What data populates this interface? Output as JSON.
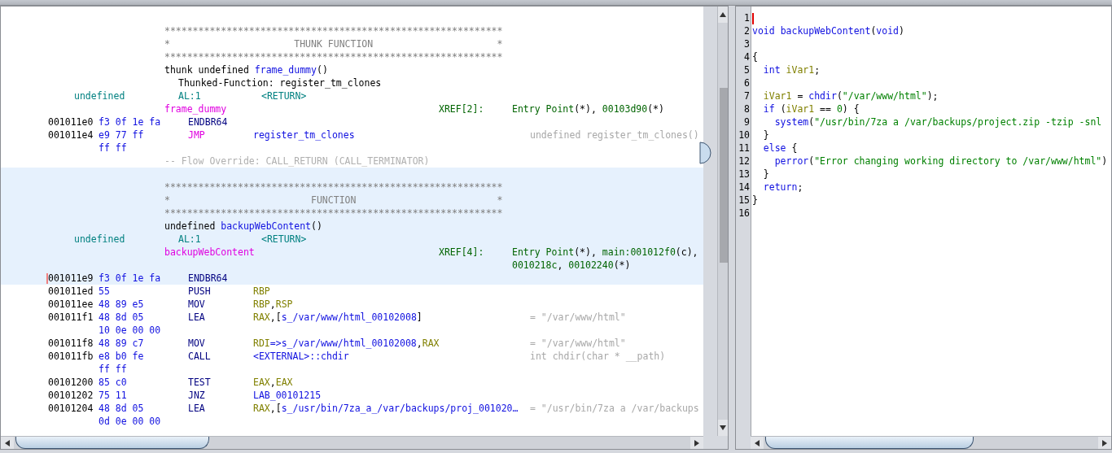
{
  "listing": {
    "lines": [
      {
        "kind": "blank",
        "highlighted": false
      },
      {
        "kind": "banner",
        "highlighted": false,
        "text": "************************************************************"
      },
      {
        "kind": "banner",
        "highlighted": false,
        "text": "*                      THUNK FUNCTION                      *"
      },
      {
        "kind": "banner",
        "highlighted": false,
        "text": "************************************************************"
      },
      {
        "kind": "signature",
        "highlighted": false,
        "tokens": [
          {
            "text": "thunk undefined ",
            "kind": "plain"
          },
          {
            "text": "frame_dummy",
            "kind": "sym"
          },
          {
            "text": "()",
            "kind": "plain"
          }
        ]
      },
      {
        "kind": "thunked",
        "highlighted": false,
        "text": "Thunked-Function: register_tm_clones"
      },
      {
        "kind": "return",
        "highlighted": false,
        "type": "undefined",
        "storage": "AL:1",
        "name": "<RETURN>"
      },
      {
        "kind": "label",
        "highlighted": false,
        "name": "frame_dummy",
        "xref_label": "XREF[2]:",
        "xrefs": [
          {
            "text": "Entry Point",
            "kind": "ref"
          },
          {
            "text": "(*), ",
            "kind": "plain"
          },
          {
            "text": "00103d90",
            "kind": "ref"
          },
          {
            "text": "(*)",
            "kind": "plain"
          }
        ]
      },
      {
        "kind": "instruction",
        "highlighted": false,
        "cursor": false,
        "address": "001011e0",
        "bytes": "f3 0f 1e fa",
        "mnemonic": "ENDBR64",
        "jump": false
      },
      {
        "kind": "instruction",
        "highlighted": false,
        "cursor": false,
        "address": "001011e4",
        "bytes": "e9 77 ff",
        "mnemonic": "JMP",
        "jump": true,
        "operands": [
          {
            "text": "register_tm_clones",
            "kind": "sym"
          }
        ],
        "comment": "undefined register_tm_clones()"
      },
      {
        "kind": "continuation",
        "highlighted": false,
        "bytes": "ff ff"
      },
      {
        "kind": "flow_override",
        "highlighted": false,
        "text": "-- Flow Override: CALL_RETURN (CALL_TERMINATOR)"
      },
      {
        "kind": "blank",
        "highlighted": true
      },
      {
        "kind": "banner",
        "highlighted": true,
        "text": "************************************************************"
      },
      {
        "kind": "banner",
        "highlighted": true,
        "text": "*                         FUNCTION                         *"
      },
      {
        "kind": "banner",
        "highlighted": true,
        "text": "************************************************************"
      },
      {
        "kind": "signature",
        "highlighted": true,
        "tokens": [
          {
            "text": "undefined ",
            "kind": "plain"
          },
          {
            "text": "backupWebContent",
            "kind": "sym"
          },
          {
            "text": "()",
            "kind": "plain"
          }
        ]
      },
      {
        "kind": "return",
        "highlighted": true,
        "type": "undefined",
        "storage": "AL:1",
        "name": "<RETURN>"
      },
      {
        "kind": "label",
        "highlighted": true,
        "name": "backupWebContent",
        "xref_label": "XREF[4]:",
        "xrefs": [
          {
            "text": "Entry Point",
            "kind": "ref"
          },
          {
            "text": "(*), ",
            "kind": "plain"
          },
          {
            "text": "main:001012f0",
            "kind": "ref"
          },
          {
            "text": "(c),",
            "kind": "plain"
          }
        ]
      },
      {
        "kind": "xref_more",
        "highlighted": true,
        "xrefs": [
          {
            "text": "0010218c",
            "kind": "ref"
          },
          {
            "text": ", ",
            "kind": "plain"
          },
          {
            "text": "00102240",
            "kind": "ref"
          },
          {
            "text": "(*)",
            "kind": "plain"
          }
        ]
      },
      {
        "kind": "instruction",
        "highlighted": true,
        "cursor": true,
        "address": "001011e9",
        "bytes": "f3 0f 1e fa",
        "mnemonic": "ENDBR64",
        "jump": false
      },
      {
        "kind": "instruction",
        "highlighted": false,
        "cursor": false,
        "address": "001011ed",
        "bytes": "55",
        "mnemonic": "PUSH",
        "jump": false,
        "operands": [
          {
            "text": "RBP",
            "kind": "reg"
          }
        ]
      },
      {
        "kind": "instruction",
        "highlighted": false,
        "cursor": false,
        "address": "001011ee",
        "bytes": "48 89 e5",
        "mnemonic": "MOV",
        "jump": false,
        "operands": [
          {
            "text": "RBP",
            "kind": "reg"
          },
          {
            "text": ",",
            "kind": "plain"
          },
          {
            "text": "RSP",
            "kind": "reg"
          }
        ]
      },
      {
        "kind": "instruction",
        "highlighted": false,
        "cursor": false,
        "address": "001011f1",
        "bytes": "48 8d 05",
        "mnemonic": "LEA",
        "jump": false,
        "operands": [
          {
            "text": "RAX",
            "kind": "reg"
          },
          {
            "text": ",[",
            "kind": "plain"
          },
          {
            "text": "s_/var/www/html_00102008",
            "kind": "sym"
          },
          {
            "text": "]",
            "kind": "plain"
          }
        ],
        "comment": "= \"/var/www/html\""
      },
      {
        "kind": "continuation",
        "highlighted": false,
        "bytes": "10 0e 00 00"
      },
      {
        "kind": "instruction",
        "highlighted": false,
        "cursor": false,
        "address": "001011f8",
        "bytes": "48 89 c7",
        "mnemonic": "MOV",
        "jump": false,
        "operands": [
          {
            "text": "RDI",
            "kind": "reg"
          },
          {
            "text": "=>s_/var/www/html_00102008",
            "kind": "sym"
          },
          {
            "text": ",",
            "kind": "plain"
          },
          {
            "text": "RAX",
            "kind": "reg"
          }
        ],
        "comment": "= \"/var/www/html\""
      },
      {
        "kind": "instruction",
        "highlighted": false,
        "cursor": false,
        "address": "001011fb",
        "bytes": "e8 b0 fe",
        "mnemonic": "CALL",
        "jump": false,
        "operands": [
          {
            "text": "<EXTERNAL>::chdir",
            "kind": "sym"
          }
        ],
        "comment": "int chdir(char * __path)"
      },
      {
        "kind": "continuation",
        "highlighted": false,
        "bytes": "ff ff"
      },
      {
        "kind": "instruction",
        "highlighted": false,
        "cursor": false,
        "address": "00101200",
        "bytes": "85 c0",
        "mnemonic": "TEST",
        "jump": false,
        "operands": [
          {
            "text": "EAX",
            "kind": "reg"
          },
          {
            "text": ",",
            "kind": "plain"
          },
          {
            "text": "EAX",
            "kind": "reg"
          }
        ]
      },
      {
        "kind": "instruction",
        "highlighted": false,
        "cursor": false,
        "address": "00101202",
        "bytes": "75 11",
        "mnemonic": "JNZ",
        "jump": false,
        "operands": [
          {
            "text": "LAB_00101215",
            "kind": "sym"
          }
        ]
      },
      {
        "kind": "instruction",
        "highlighted": false,
        "cursor": false,
        "address": "00101204",
        "bytes": "48 8d 05",
        "mnemonic": "LEA",
        "jump": false,
        "operands": [
          {
            "text": "RAX",
            "kind": "reg"
          },
          {
            "text": ",[",
            "kind": "plain"
          },
          {
            "text": "s_/usr/bin/7za_a_/var/backups/proj_001020…",
            "kind": "sym"
          }
        ],
        "comment": "= \"/usr/bin/7za a /var/backups"
      },
      {
        "kind": "continuation",
        "highlighted": false,
        "bytes": "0d 0e 00 00"
      }
    ]
  },
  "decompiler": {
    "lines": [
      {
        "number": "1",
        "cursor": true
      },
      {
        "number": "2",
        "cursor": false,
        "tokens": [
          {
            "text": "void ",
            "kind": "kw"
          },
          {
            "text": "backupWebContent",
            "kind": "fn"
          },
          {
            "text": "(",
            "kind": "plain"
          },
          {
            "text": "void",
            "kind": "kw"
          },
          {
            "text": ")",
            "kind": "plain"
          }
        ]
      },
      {
        "number": "3",
        "cursor": false
      },
      {
        "number": "4",
        "cursor": false,
        "tokens": [
          {
            "text": "{",
            "kind": "plain"
          }
        ]
      },
      {
        "number": "5",
        "cursor": false,
        "tokens": [
          {
            "text": "  int ",
            "kind": "kw"
          },
          {
            "text": "iVar1",
            "kind": "var"
          },
          {
            "text": ";",
            "kind": "plain"
          }
        ]
      },
      {
        "number": "6",
        "cursor": false
      },
      {
        "number": "7",
        "cursor": false,
        "tokens": [
          {
            "text": "  iVar1",
            "kind": "var"
          },
          {
            "text": " = ",
            "kind": "plain"
          },
          {
            "text": "chdir",
            "kind": "fn"
          },
          {
            "text": "(",
            "kind": "plain"
          },
          {
            "text": "\"/var/www/html\"",
            "kind": "str"
          },
          {
            "text": ");",
            "kind": "plain"
          }
        ]
      },
      {
        "number": "8",
        "cursor": false,
        "tokens": [
          {
            "text": "  if",
            "kind": "kw"
          },
          {
            "text": " (",
            "kind": "plain"
          },
          {
            "text": "iVar1",
            "kind": "var"
          },
          {
            "text": " == ",
            "kind": "plain"
          },
          {
            "text": "0",
            "kind": "num"
          },
          {
            "text": ") {",
            "kind": "plain"
          }
        ]
      },
      {
        "number": "9",
        "cursor": false,
        "tokens": [
          {
            "text": "    system",
            "kind": "fn"
          },
          {
            "text": "(",
            "kind": "plain"
          },
          {
            "text": "\"/usr/bin/7za a /var/backups/project.zip -tzip -snl",
            "kind": "str"
          }
        ]
      },
      {
        "number": "10",
        "cursor": false,
        "tokens": [
          {
            "text": "  }",
            "kind": "plain"
          }
        ]
      },
      {
        "number": "11",
        "cursor": false,
        "tokens": [
          {
            "text": "  else",
            "kind": "kw"
          },
          {
            "text": " {",
            "kind": "plain"
          }
        ]
      },
      {
        "number": "12",
        "cursor": false,
        "tokens": [
          {
            "text": "    perror",
            "kind": "fn"
          },
          {
            "text": "(",
            "kind": "plain"
          },
          {
            "text": "\"Error changing working directory to /var/www/html\"",
            "kind": "str"
          },
          {
            "text": ")",
            "kind": "plain"
          }
        ]
      },
      {
        "number": "13",
        "cursor": false,
        "tokens": [
          {
            "text": "  }",
            "kind": "plain"
          }
        ]
      },
      {
        "number": "14",
        "cursor": false,
        "tokens": [
          {
            "text": "  return",
            "kind": "kw"
          },
          {
            "text": ";",
            "kind": "plain"
          }
        ]
      },
      {
        "number": "15",
        "cursor": false,
        "tokens": [
          {
            "text": "}",
            "kind": "plain"
          }
        ]
      },
      {
        "number": "16",
        "cursor": false
      }
    ]
  }
}
